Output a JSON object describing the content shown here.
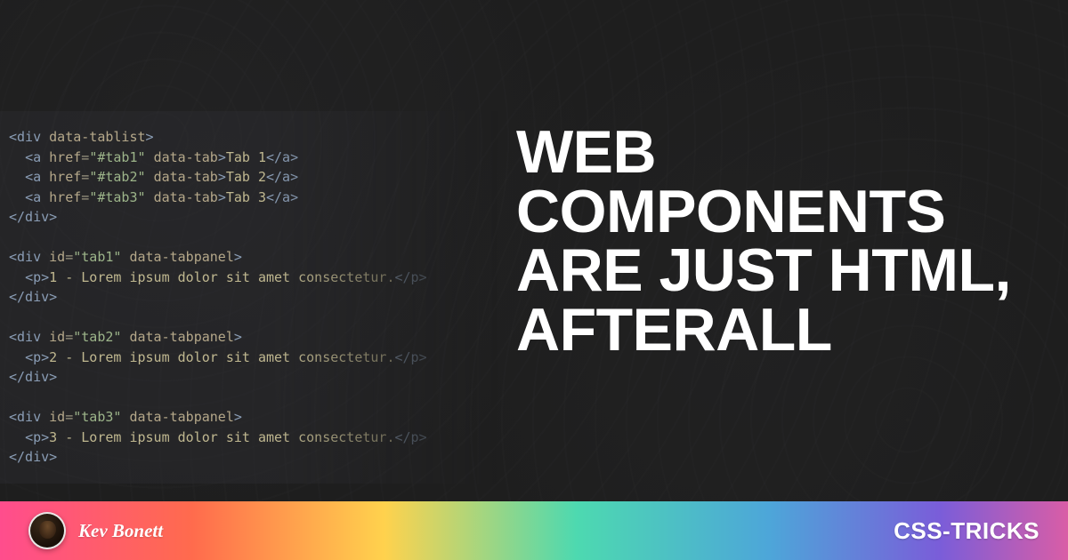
{
  "title": "WEB COMPONENTS ARE JUST HTML, AFTERALL",
  "author": {
    "name": "Kev Bonett"
  },
  "brand": "CSS-TRICKS",
  "code": {
    "lines": [
      {
        "raw": "<div data-tablist>"
      },
      {
        "raw": "  <a href=\"#tab1\" data-tab>Tab 1</a>"
      },
      {
        "raw": "  <a href=\"#tab2\" data-tab>Tab 2</a>"
      },
      {
        "raw": "  <a href=\"#tab3\" data-tab>Tab 3</a>"
      },
      {
        "raw": "</div>"
      },
      {
        "raw": ""
      },
      {
        "raw": "<div id=\"tab1\" data-tabpanel>"
      },
      {
        "raw": "  <p>1 - Lorem ipsum dolor sit amet consectetur.</p>"
      },
      {
        "raw": "</div>"
      },
      {
        "raw": ""
      },
      {
        "raw": "<div id=\"tab2\" data-tabpanel>"
      },
      {
        "raw": "  <p>2 - Lorem ipsum dolor sit amet consectetur.</p>"
      },
      {
        "raw": "</div>"
      },
      {
        "raw": ""
      },
      {
        "raw": "<div id=\"tab3\" data-tabpanel>"
      },
      {
        "raw": "  <p>3 - Lorem ipsum dolor sit amet consectetur.</p>"
      },
      {
        "raw": "</div>"
      }
    ]
  }
}
